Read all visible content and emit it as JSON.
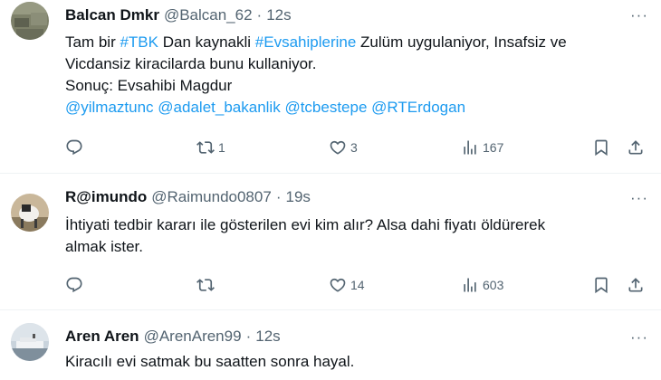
{
  "tweets": [
    {
      "name": "Balcan Dmkr",
      "handle": "@Balcan_62",
      "time": "12s",
      "more": "···",
      "line1": {
        "t1": "Tam bir ",
        "h1": "#TBK",
        "t2": " Dan kaynakli ",
        "h2": "#Evsahiplerine",
        "t3": " Zulüm uygulaniyor, Insafsiz ve"
      },
      "line2": "Vicdansiz kiracilarda bunu kullaniyor.",
      "line3": "Sonuç: Evsahibi Magdur",
      "mentions": [
        "@yilmaztunc",
        "@adalet_bakanlik",
        "@tcbestepe",
        "@RTErdogan"
      ],
      "replies": "",
      "retweets": "1",
      "likes": "3",
      "views": "167"
    },
    {
      "name": "R@imundo",
      "handle": "@Raimundo0807",
      "time": "19s",
      "more": "···",
      "line1": "İhtiyati tedbir kararı ile gösterilen evi kim alır? Alsa dahi fiyatı öldürerek",
      "line2": "almak ister.",
      "replies": "",
      "retweets": "",
      "likes": "14",
      "views": "603"
    },
    {
      "name": "Aren Aren",
      "handle": "@ArenAren99",
      "time": "12s",
      "more": "···",
      "line1": "Kiracılı evi satmak bu saatten sonra hayal."
    }
  ],
  "dot": "·",
  "colors": {
    "link": "#1d9bf0",
    "muted": "#536471",
    "text": "#0f1419",
    "divider": "#eff3f4"
  },
  "icons": [
    "reply-icon",
    "retweet-icon",
    "like-icon",
    "views-icon",
    "bookmark-icon",
    "share-icon",
    "more-icon"
  ]
}
